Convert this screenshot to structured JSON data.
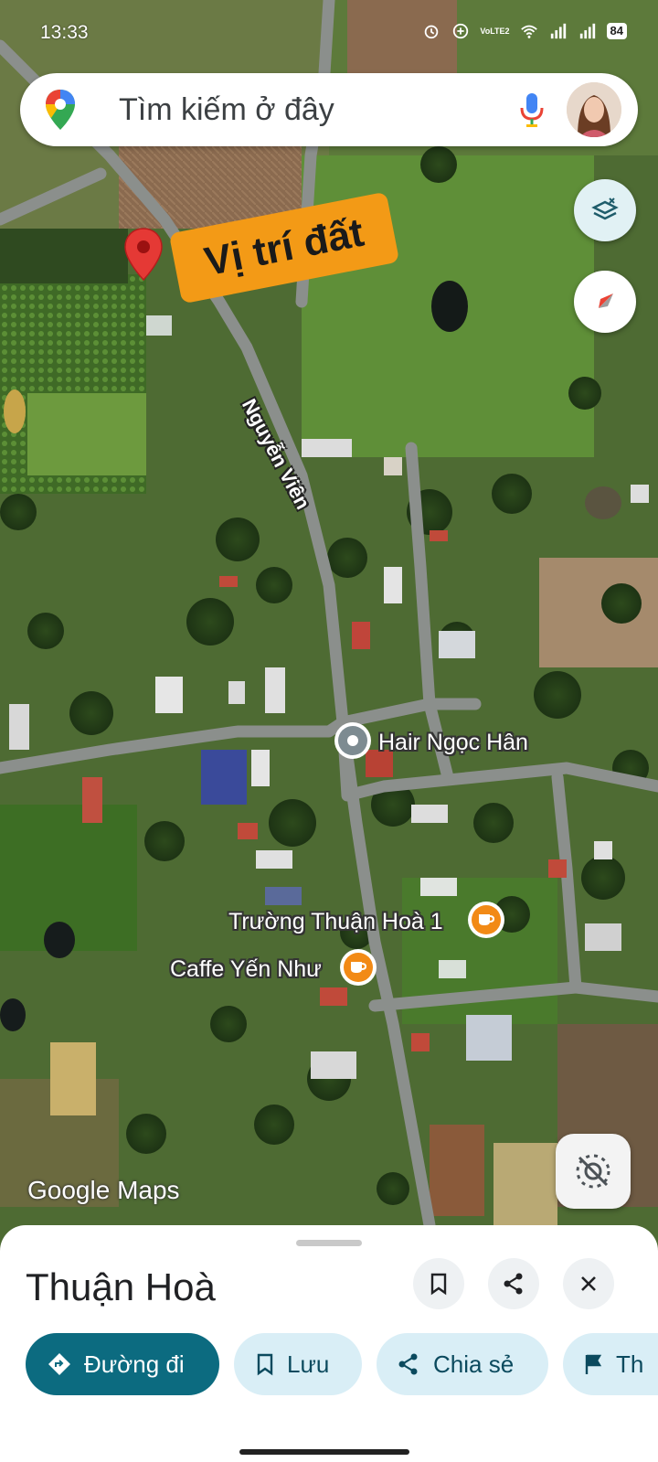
{
  "status_bar": {
    "time": "13:33",
    "battery": "84",
    "network": "VoLTE2"
  },
  "search": {
    "placeholder": "Tìm kiếm ở đây",
    "logo_icon": "google-maps-pin-icon",
    "mic_icon": "mic-icon"
  },
  "map": {
    "location_tag": "Vị trí đất",
    "road_label": "Nguyễn Viên",
    "pois": [
      {
        "label": "Hair Ngọc Hân",
        "icon": "place-pin-icon"
      },
      {
        "label": "Trường Thuận Hoà 1",
        "icon": "cafe-icon"
      },
      {
        "label": "Caffe Yến Như",
        "icon": "cafe-icon"
      }
    ],
    "watermark": "Google Maps",
    "colors": {
      "pin_red": "#e53935",
      "tag_orange": "#f39a16",
      "cafe_orange": "#f28a16"
    }
  },
  "sheet": {
    "title": "Thuận Hoà",
    "actions": {
      "directions": "Đường đi",
      "save": "Lưu",
      "share": "Chia sẻ",
      "more": "Th"
    },
    "colors": {
      "primary_chip": "#0c6b80",
      "secondary_chip": "#d9eef6"
    }
  }
}
